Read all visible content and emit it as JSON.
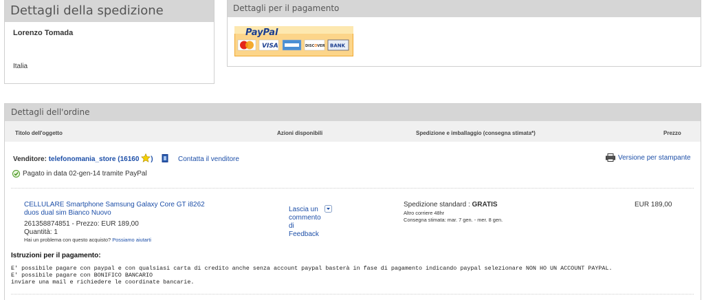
{
  "shipping": {
    "title": "Dettagli della spedizione",
    "name": "Lorenzo Tomada",
    "country": "Italia"
  },
  "payment": {
    "title": "Dettagli per il pagamento",
    "logo_text": "PayPal",
    "cards": [
      "MasterCard",
      "VISA",
      "AMEX",
      "DISCOVER",
      "BANK"
    ]
  },
  "order": {
    "title": "Dettagli dell'ordine",
    "columns": {
      "item": "Titolo dell'oggetto",
      "actions": "Azioni disponibili",
      "shipping": "Spedizione e imballaggio (consegna stimata*)",
      "price": "Prezzo"
    },
    "seller_label": "Venditore:",
    "seller_name": "telefonomania_store",
    "feedback_open": "(",
    "feedback_score": "16160",
    "feedback_close": ")",
    "contact_seller": "Contatta il venditore",
    "print_version": "Versione per stampante",
    "paid_status": "Pagato in data 02-gen-14 tramite PayPal",
    "item": {
      "title_line1": "CELLULARE Smartphone Samsung Galaxy Core GT i8262",
      "title_line2": "duos dual sim Bianco Nuovo",
      "id_price": "261358874851 - Prezzo: EUR 189,00",
      "quantity": "Quantità: 1",
      "problem_text": "Hai un problema con questo acquisto?",
      "problem_link": "Possiamo aiutarti",
      "action_lines": [
        "Lascia un",
        "commento",
        "di",
        "Feedback"
      ],
      "shipping_label": "Spedizione standard : ",
      "shipping_value": "GRATIS",
      "shipping_alt": "Altro corriere 48hr",
      "shipping_estimate": "Consegna stimata: mar. 7 gen. - mer. 8 gen.",
      "price": "EUR 189,00"
    },
    "instructions_title": "Istruzioni per il pagamento:",
    "instructions": [
      "E' possibile pagare con paypal e con qualsiasi carta di credito anche senza account paypal basterà in fase di pagamento indicando paypal selezionare NON HO UN ACCOUNT PAYPAL.",
      "E' possibile pagare con BONIFICO BANCARIO",
      "inviare una mail e richiedere le coordinate bancarie."
    ]
  },
  "colors": {
    "link": "#1d4fa8",
    "header_bg": "#d6d6d6",
    "paypal_blue": "#1a3d8f",
    "paypal_cyan": "#2c9cd6"
  }
}
